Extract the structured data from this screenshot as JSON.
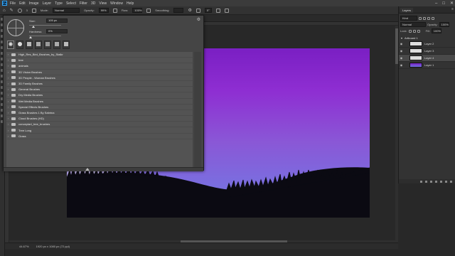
{
  "menubar": {
    "items": [
      "File",
      "Edit",
      "Image",
      "Layer",
      "Type",
      "Select",
      "Filter",
      "3D",
      "View",
      "Window",
      "Help"
    ]
  },
  "options": {
    "size": "3",
    "mode_label": "Mode:",
    "mode_value": "Normal",
    "opacity_label": "Opacity:",
    "opacity_value": "99%",
    "flow_label": "Flow:",
    "flow_value": "100%",
    "smoothing_label": "Smoothing:",
    "smoothing_value": "",
    "angle_value": "0°"
  },
  "brush_panel": {
    "size_label": "Size:",
    "size_value": "105 px",
    "hardness_label": "Hardness:",
    "hardness_value": "0%",
    "folders": [
      "High_Res_Bird_Brushes_by_Stalkr",
      "tree",
      "animals",
      "3D Vision Brushes",
      "3D People - Woman Brushes",
      "3D Family Brushes",
      "General Brushes",
      "Dry Media Brushes",
      "Wet Media Brushes",
      "Special Effects Brushes",
      "Grass Brushes 1 By Sabrina",
      "Cloud Brushes (HD)",
      "conceptart_tree_brushes",
      "Tree Long",
      "Grass"
    ]
  },
  "layers_panel": {
    "tab_label": "Layers",
    "kind_label": "Kind",
    "blend_mode": "Normal",
    "opacity_label": "Opacity:",
    "opacity_value": "100%",
    "lock_label": "Lock:",
    "fill_label": "Fill:",
    "fill_value": "100%",
    "artboard_name": "Artboard 1",
    "layers": [
      {
        "name": "Layer 2"
      },
      {
        "name": "Layer 3"
      },
      {
        "name": "Layer 4"
      },
      {
        "name": "Layer 1"
      }
    ]
  },
  "status": {
    "zoom": "44.67%",
    "doc_info": "1920 px x 1080 px (72 ppi)"
  },
  "colors": {
    "accent": "#31a8ff",
    "sky_top": "#7a1fc3",
    "sky_bottom": "#6f73e0",
    "hill": "#0b0a12"
  }
}
